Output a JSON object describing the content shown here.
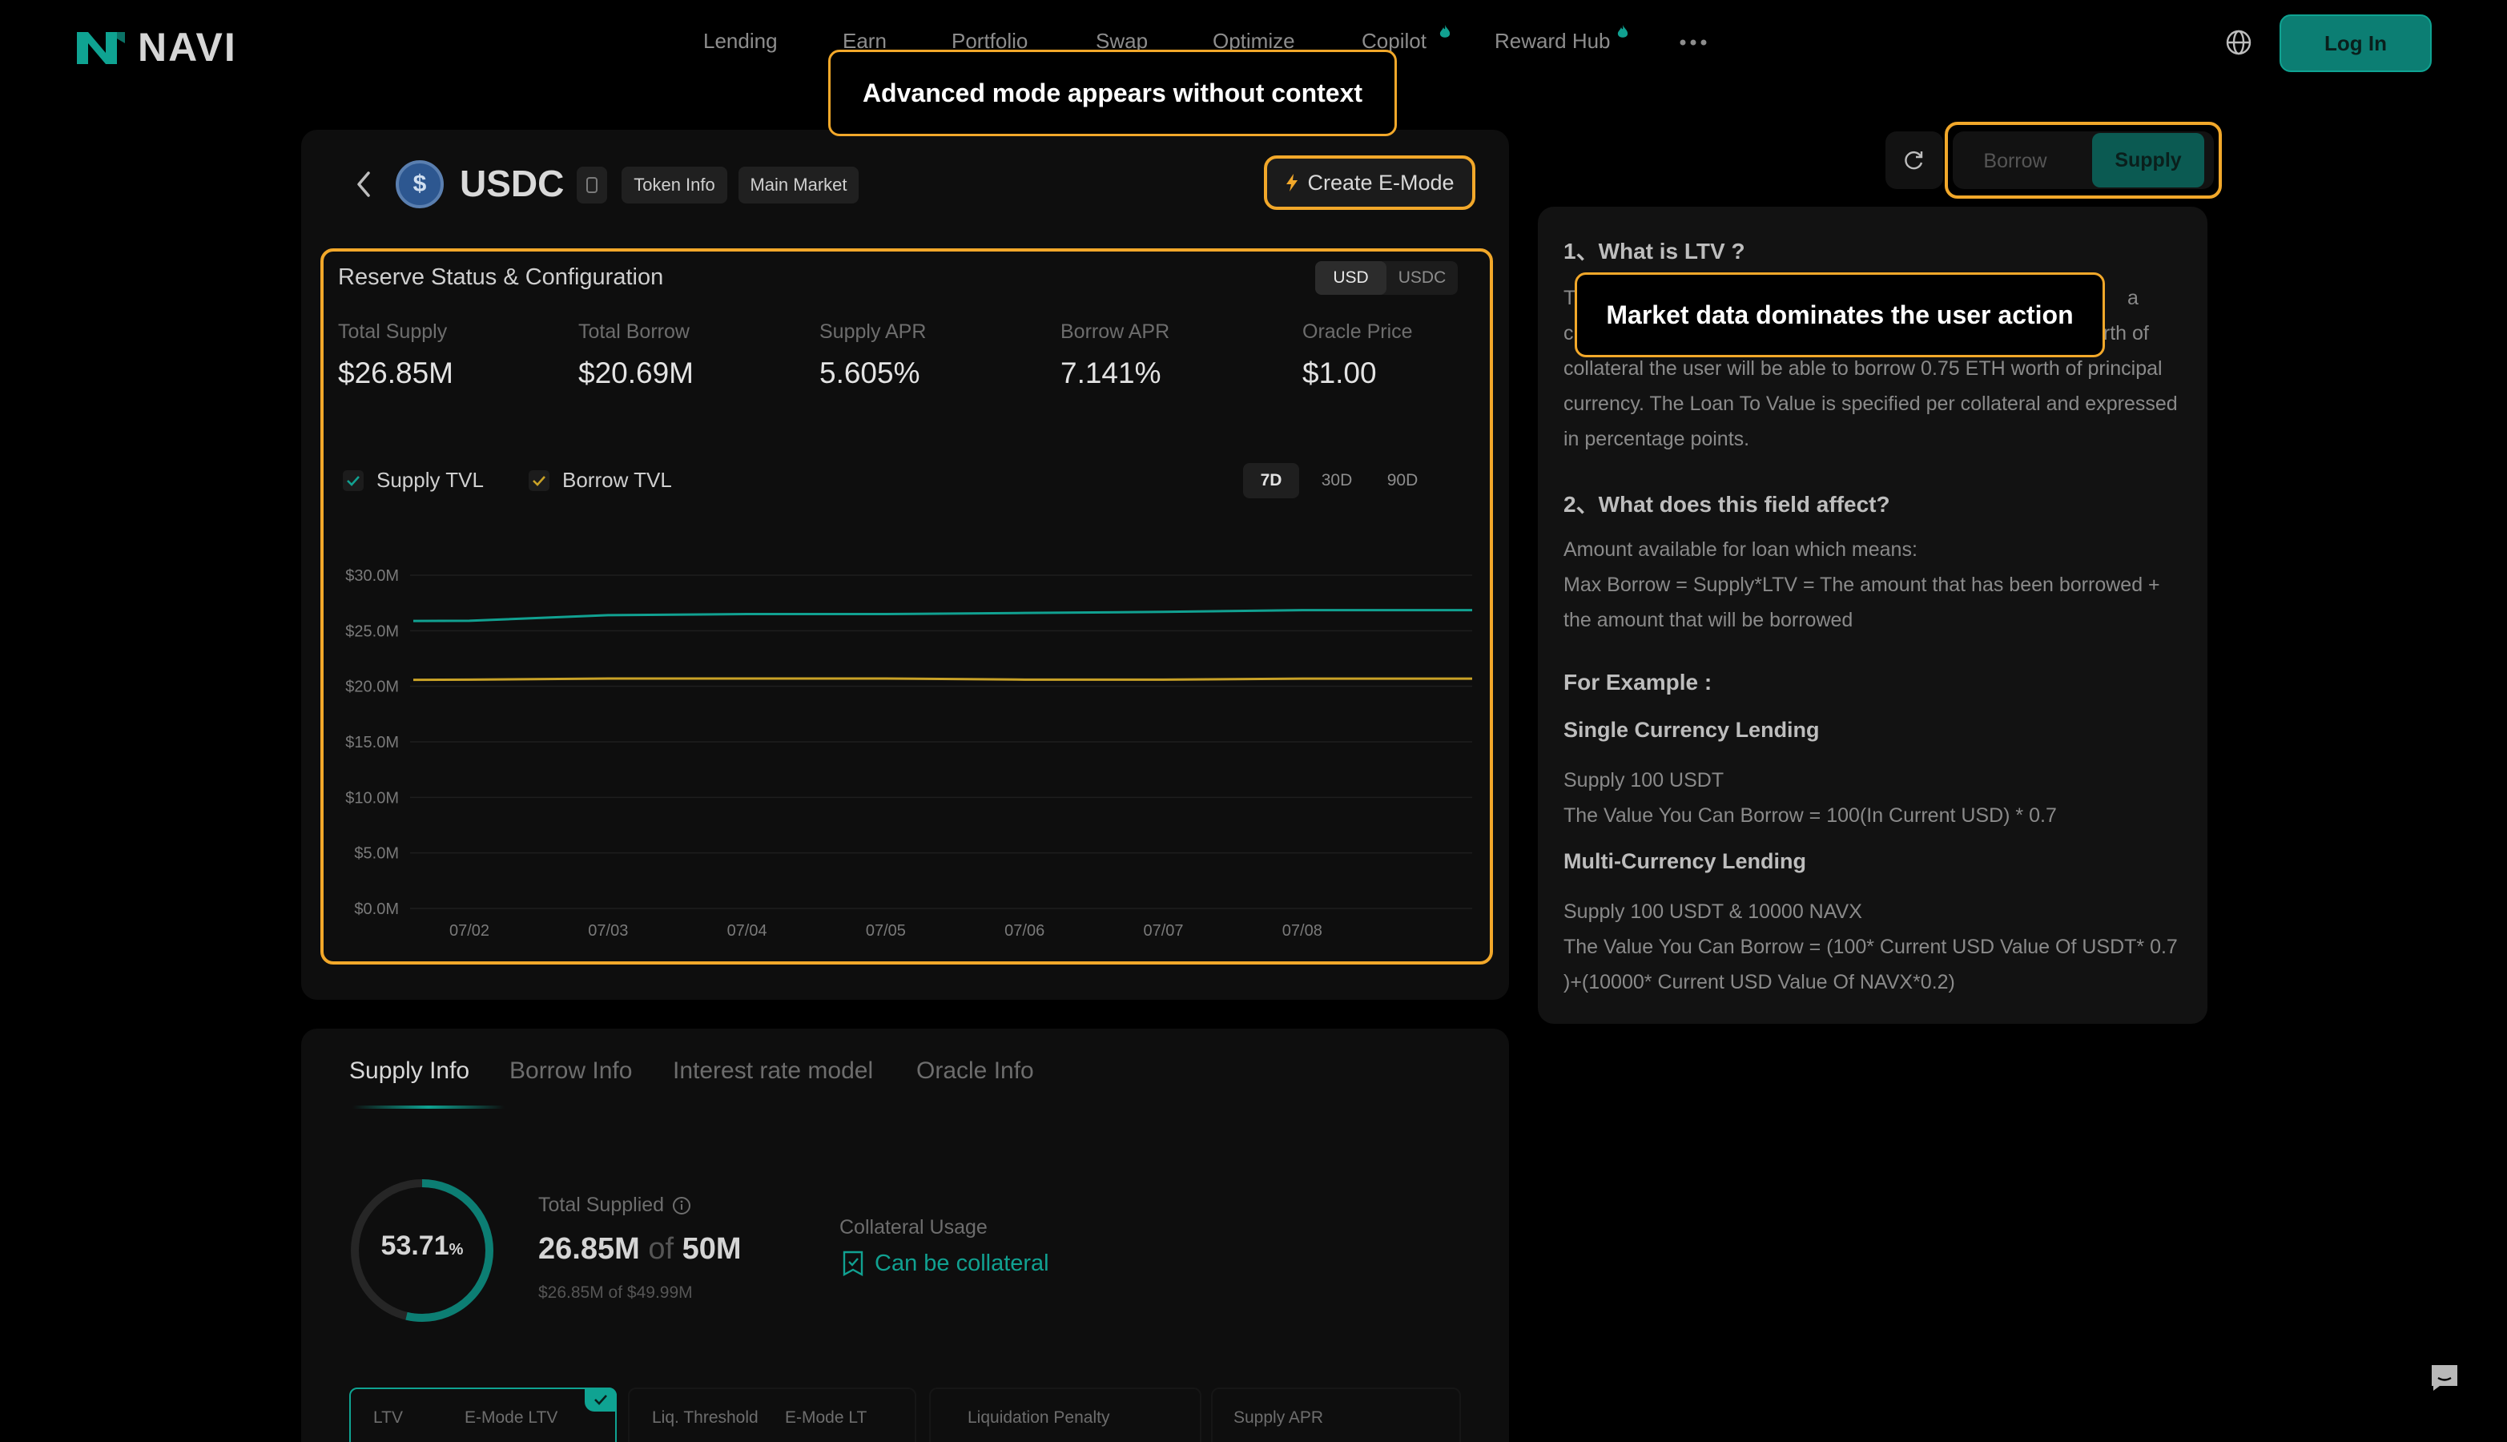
{
  "header": {
    "brand": "NAVI",
    "nav": [
      {
        "label": "Lending",
        "fire": false
      },
      {
        "label": "Earn",
        "fire": false
      },
      {
        "label": "Portfolio",
        "fire": false
      },
      {
        "label": "Swap",
        "fire": false
      },
      {
        "label": "Optimize",
        "fire": false
      },
      {
        "label": "Copilot",
        "fire": true
      },
      {
        "label": "Reward Hub",
        "fire": true
      }
    ],
    "more_icon": "ellipsis-icon",
    "globe_icon": "globe-icon",
    "login_label": "Log In"
  },
  "asset": {
    "symbol": "USDC",
    "chips": [
      "Token Info",
      "Main Market"
    ],
    "create_emode": "Create E-Mode"
  },
  "reserve": {
    "title": "Reserve Status & Configuration",
    "currency_toggle": [
      "USD",
      "USDC"
    ],
    "currency_selected": "USD",
    "stats": [
      {
        "label": "Total Supply",
        "value": "$26.85M"
      },
      {
        "label": "Total Borrow",
        "value": "$20.69M"
      },
      {
        "label": "Supply APR",
        "value": "5.605%"
      },
      {
        "label": "Borrow APR",
        "value": "7.141%"
      },
      {
        "label": "Oracle Price",
        "value": "$1.00"
      }
    ],
    "legend": [
      {
        "label": "Supply TVL",
        "color": "#11a191",
        "checked": true
      },
      {
        "label": "Borrow TVL",
        "color": "#c9a227",
        "checked": true
      }
    ],
    "ranges": [
      "7D",
      "30D",
      "90D"
    ],
    "range_selected": "7D"
  },
  "chart_data": {
    "type": "line",
    "x": [
      "07/02",
      "07/03",
      "07/04",
      "07/05",
      "07/06",
      "07/07",
      "07/08"
    ],
    "y_ticks": [
      "$30.0M",
      "$25.0M",
      "$20.0M",
      "$15.0M",
      "$10.0M",
      "$5.0M",
      "$0.0M"
    ],
    "ylim": [
      0,
      30
    ],
    "series": [
      {
        "name": "Supply TVL",
        "color": "#11a191",
        "values": [
          25.9,
          26.4,
          26.5,
          26.5,
          26.6,
          26.7,
          26.85
        ]
      },
      {
        "name": "Borrow TVL",
        "color": "#c9a227",
        "values": [
          20.6,
          20.7,
          20.7,
          20.7,
          20.6,
          20.6,
          20.69
        ]
      }
    ]
  },
  "side_toggle": {
    "borrow": "Borrow",
    "supply": "Supply",
    "selected": "Supply",
    "refresh_icon": "refresh-icon"
  },
  "ltv_info": {
    "q1": "1、What is LTV ?",
    "q1_line1_start": "T",
    "q1_line1_end": "a",
    "q1_line2_start": "c",
    "q1_line2_end": "orth of",
    "q1_body": "collateral the user will be able to borrow 0.75 ETH worth of principal currency. The Loan To Value is specified per collateral and expressed in percentage points.",
    "q2": "2、What does this field affect?",
    "q2_body1": "Amount available for loan which means:",
    "q2_body2": "Max Borrow = Supply*LTV = The amount that has been borrowed + the amount that will be borrowed",
    "example_title": "For Example :",
    "single_title": "Single Currency Lending",
    "single_body1": "Supply 100 USDT",
    "single_body2": "The Value You Can Borrow = 100(In Current USD) * 0.7",
    "multi_title": "Multi-Currency Lending",
    "multi_body1": "Supply 100 USDT & 10000 NAVX",
    "multi_body2": "The Value You Can Borrow = (100* Current USD Value Of USDT* 0.7 )+(10000* Current USD Value Of NAVX*0.2)"
  },
  "info_tabs": {
    "tabs": [
      "Supply Info",
      "Borrow Info",
      "Interest rate model",
      "Oracle Info"
    ],
    "selected": "Supply Info"
  },
  "supply_info": {
    "utilization": 53.71,
    "utilization_text": "53.71",
    "utilization_unit": "%",
    "total_supplied_label": "Total Supplied",
    "total_supplied_value": "26.85M",
    "of_word": "of",
    "total_supplied_cap": "50M",
    "total_supplied_sub": "$26.85M of $49.99M",
    "collateral_label": "Collateral Usage",
    "collateral_value": "Can be collateral",
    "metrics": [
      {
        "label": "LTV",
        "label2": "E-Mode LTV"
      },
      {
        "label": "Liq. Threshold",
        "label2": "E-Mode LT"
      },
      {
        "label": "Liquidation Penalty",
        "label2": ""
      },
      {
        "label": "Supply APR",
        "label2": ""
      }
    ]
  },
  "annotations": {
    "callout_advanced": "Advanced mode appears without context",
    "callout_market": "Market data dominates the user action",
    "accent_color": "#f2a82a"
  },
  "colors": {
    "brand": "#0fa392",
    "supply_line": "#11a191",
    "borrow_line": "#c9a227",
    "background": "#000000"
  }
}
